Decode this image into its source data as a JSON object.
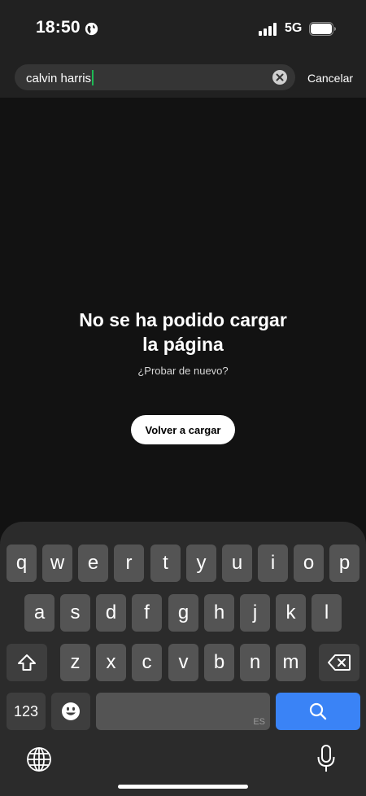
{
  "status_bar": {
    "time": "18:50",
    "network": "5G",
    "icons": [
      "globe-icon",
      "signal-bars-icon",
      "battery-icon"
    ]
  },
  "search": {
    "query": "calvin harris",
    "cancel_label": "Cancelar"
  },
  "error": {
    "title_line1": "No se ha podido cargar",
    "title_line2": "la página",
    "subtitle": "¿Probar de nuevo?",
    "reload_label": "Volver a cargar"
  },
  "keyboard": {
    "row1": [
      "q",
      "w",
      "e",
      "r",
      "t",
      "y",
      "u",
      "i",
      "o",
      "p"
    ],
    "row2": [
      "a",
      "s",
      "d",
      "f",
      "g",
      "h",
      "j",
      "k",
      "l"
    ],
    "row3": [
      "z",
      "x",
      "c",
      "v",
      "b",
      "n",
      "m"
    ],
    "numbers_label": "123",
    "space_lang": "ES",
    "accent_color": "#3a83f6"
  },
  "colors": {
    "background": "#121212",
    "header": "#212121",
    "caret": "#1db954"
  }
}
